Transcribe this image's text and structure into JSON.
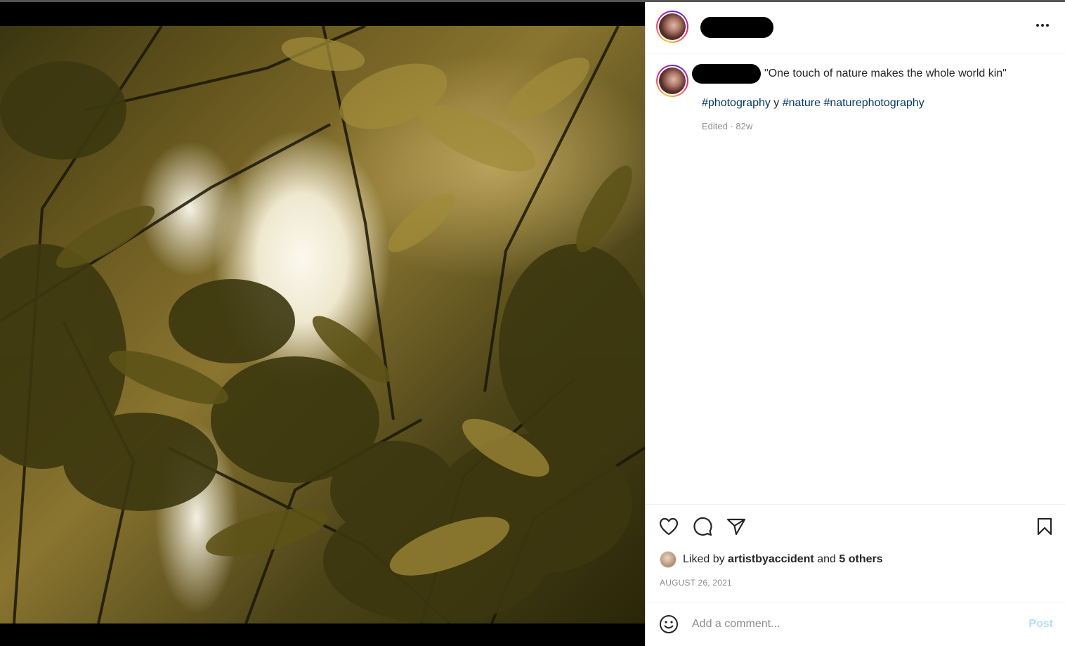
{
  "post": {
    "caption": "\"One touch of nature makes the whole world kin\"",
    "hashtags": [
      "#photography",
      "#nature",
      "#naturephotography"
    ],
    "hashtag_joiner": " y ",
    "edited_label": "Edited · 82w"
  },
  "actions": {
    "like_icon": "heart-icon",
    "comment_icon": "comment-icon",
    "share_icon": "paper-plane-icon",
    "save_icon": "bookmark-icon"
  },
  "likes": {
    "prefix": "Liked by",
    "user": "artistbyaccident",
    "joiner": "and",
    "others": "5 others"
  },
  "date": "AUGUST 26, 2021",
  "comment": {
    "placeholder": "Add a comment...",
    "post_label": "Post",
    "emoji_icon": "emoji-icon"
  },
  "colors": {
    "link": "#00376b",
    "muted": "#8e8e8e",
    "post_button_disabled": "#b2dffc"
  }
}
